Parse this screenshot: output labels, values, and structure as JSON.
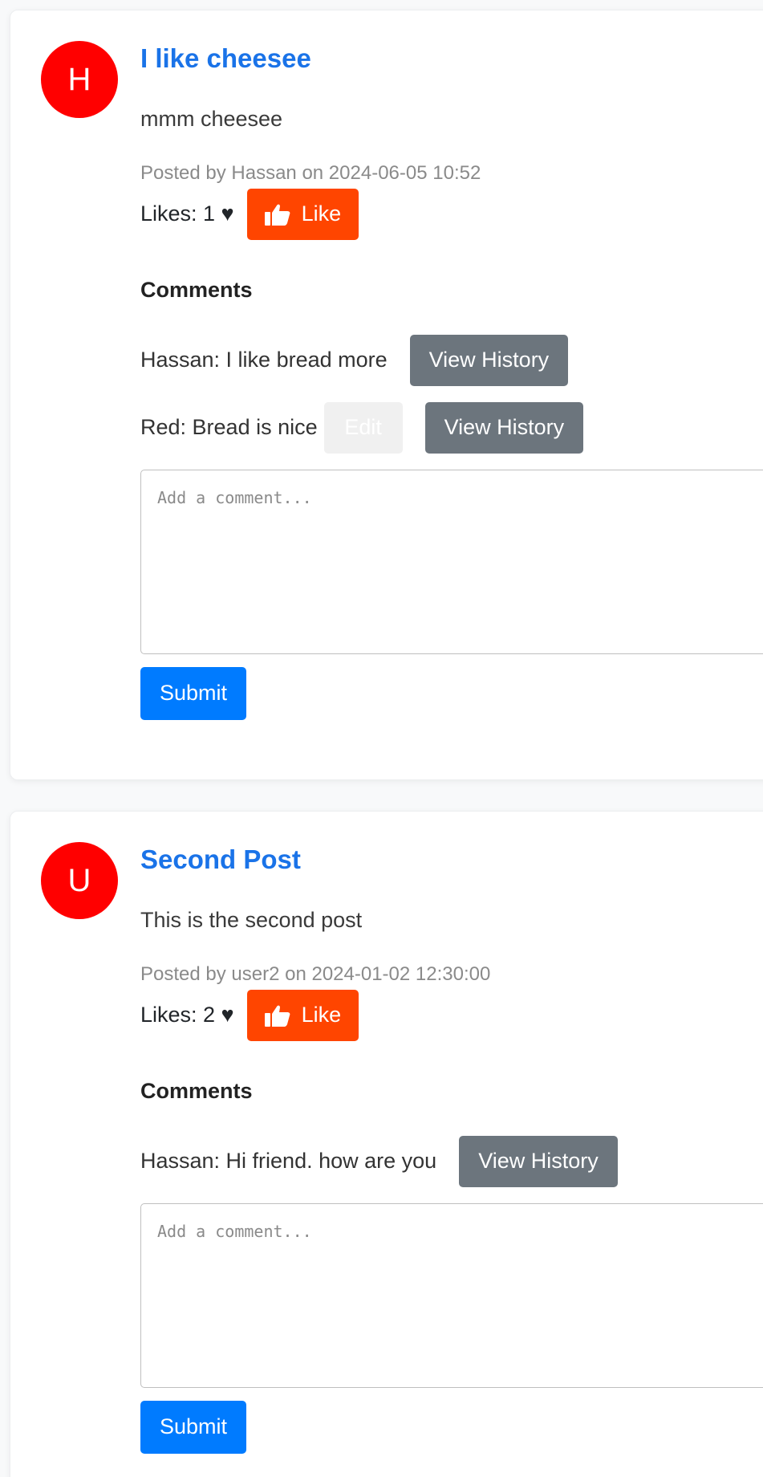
{
  "posts": [
    {
      "avatar_letter": "H",
      "title": "I like cheesee",
      "content": "mmm cheesee",
      "meta": "Posted by Hassan on 2024-06-05 10:52",
      "likes_text": "Likes: 1 ♥",
      "like_label": "Like",
      "comments_heading": "Comments",
      "comments": [
        {
          "text": "Hassan: I like bread more",
          "history_label": "View History"
        },
        {
          "text": "Red: Bread is nice",
          "edit_label": "Edit",
          "history_label": "View History"
        }
      ],
      "comment_placeholder": "Add a comment...",
      "submit_label": "Submit"
    },
    {
      "avatar_letter": "U",
      "title": "Second Post",
      "content": "This is the second post",
      "meta": "Posted by user2 on 2024-01-02 12:30:00",
      "likes_text": "Likes: 2 ♥",
      "like_label": "Like",
      "comments_heading": "Comments",
      "comments": [
        {
          "text": "Hassan: Hi friend. how are you",
          "history_label": "View History"
        }
      ],
      "comment_placeholder": "Add a comment...",
      "submit_label": "Submit"
    }
  ],
  "colors": {
    "avatar": "#ff0000",
    "title": "#1a73e8",
    "like_button": "#ff4500",
    "history_button": "#6c757d",
    "submit_button": "#007bff"
  },
  "icons": {
    "like": "thumbs-up-icon"
  }
}
